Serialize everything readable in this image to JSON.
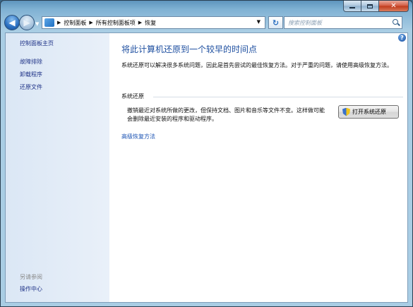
{
  "titlebar": {
    "caption_buttons": [
      "minimize",
      "maximize",
      "close"
    ]
  },
  "navigation": {
    "breadcrumb": [
      "控制面板",
      "所有控制面板项",
      "恢复"
    ],
    "search_placeholder": "搜索控制面板"
  },
  "sidebar": {
    "home": "控制面板主页",
    "links": [
      "故障排除",
      "卸载程序",
      "还原文件"
    ],
    "see_also_heading": "另请参阅",
    "see_also_links": [
      "操作中心"
    ]
  },
  "main": {
    "title": "将此计算机还原到一个较早的时间点",
    "intro": "系统还原可以解决很多系统问题，因此是首先尝试的最佳恢复方法。对于严重的问题，请使用高级恢复方法。",
    "section_heading": "系统还原",
    "restore_description": "撤销最近对系统所做的更改，但保持文档、图片和音乐等文件不变。这样做可能会删除最近安装的程序和驱动程序。",
    "open_restore_button": "打开系统还原",
    "advanced_link": "高级恢复方法"
  },
  "colors": {
    "title_blue": "#1e4fa0",
    "link_blue": "#1e3287",
    "sidebar_bg": "#dbe7f5",
    "frame": "#a9cde4"
  }
}
